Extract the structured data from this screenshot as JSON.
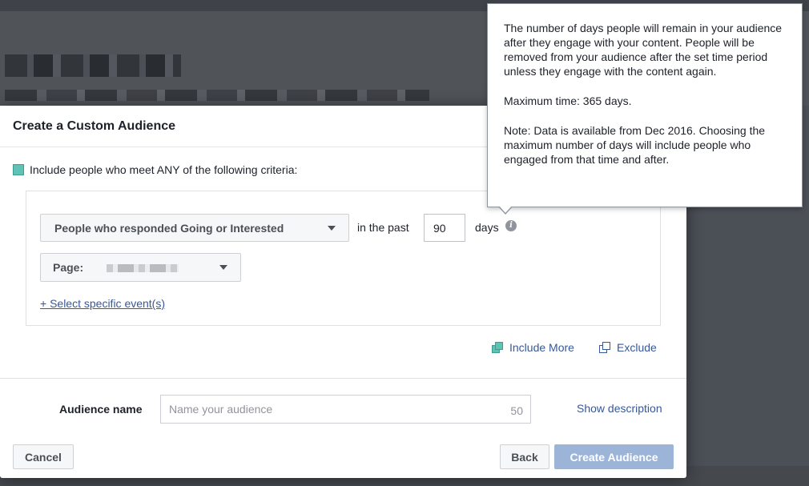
{
  "dialog": {
    "title": "Create a Custom Audience",
    "criteria_text": "Include people who meet ANY of the following criteria:",
    "rule": {
      "event_select": "People who responded Going or Interested",
      "in_the_past_label": "in the past",
      "days_value": "90",
      "days_label": "days",
      "page_label": "Page:",
      "select_events_link": "+ Select specific event(s)"
    },
    "include_more": "Include More",
    "exclude": "Exclude",
    "audience_name_label": "Audience name",
    "audience_name_placeholder": "Name your audience",
    "char_limit": "50",
    "show_description": "Show description",
    "cancel": "Cancel",
    "back": "Back",
    "create": "Create Audience"
  },
  "tooltip": {
    "p1": "The number of days people will remain in your audience after they engage with your content. People will be removed from your audience after the set time period unless they engage with the content again.",
    "p2": "Maximum time: 365 days.",
    "p3": "Note: Data is available from Dec 2016. Choosing the maximum number of days will include people who engaged from that time and after."
  },
  "colors": {
    "accent_teal": "#5fc2b4",
    "link_blue": "#365899",
    "primary_disabled": "#9cb4d8"
  }
}
